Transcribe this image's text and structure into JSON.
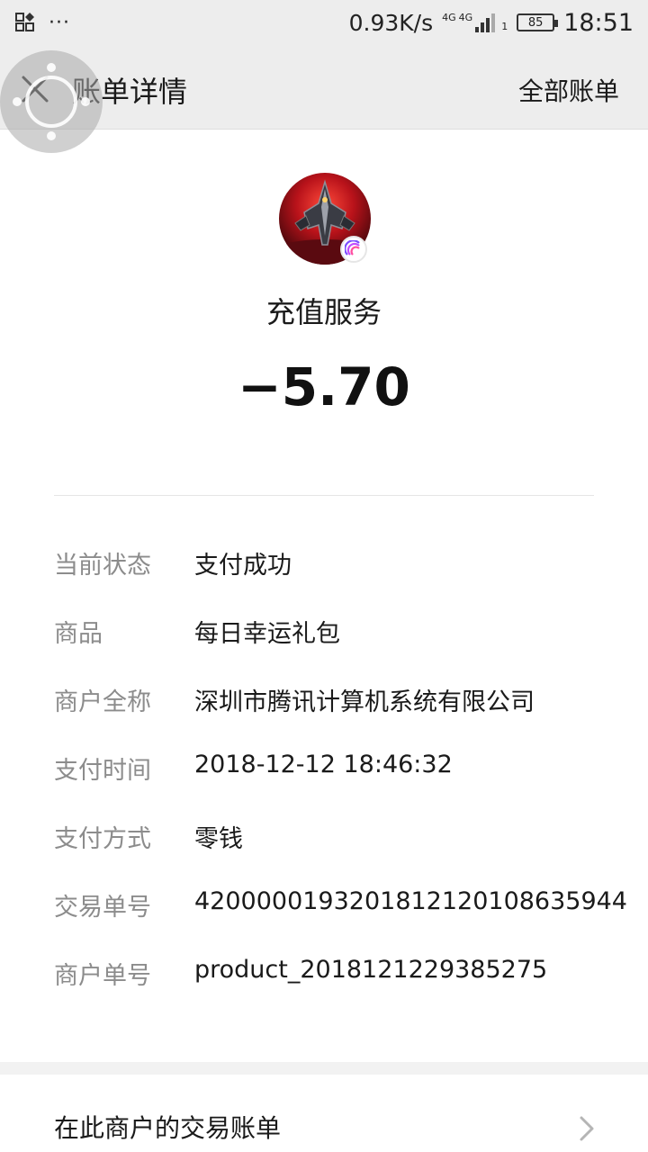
{
  "status_bar": {
    "net_speed": "0.93K/s",
    "signal_1": "4G",
    "signal_2": "4G",
    "sim": "1",
    "battery": "85",
    "time": "18:51"
  },
  "header": {
    "title": "账单详情",
    "all_bills": "全部账单"
  },
  "merchant": {
    "name": "充值服务",
    "amount": "−5.70"
  },
  "details": [
    {
      "label": "当前状态",
      "value": "支付成功"
    },
    {
      "label": "商品",
      "value": "每日幸运礼包"
    },
    {
      "label": "商户全称",
      "value": "深圳市腾讯计算机系统有限公司"
    },
    {
      "label": "支付时间",
      "value": "2018-12-12 18:46:32"
    },
    {
      "label": "支付方式",
      "value": "零钱"
    },
    {
      "label": "交易单号",
      "value": "4200000193201812120108635944"
    },
    {
      "label": "商户单号",
      "value": "product_2018121229385275"
    }
  ],
  "footer_link": {
    "label": "在此商户的交易账单"
  },
  "icons": {
    "close": "close-icon",
    "chevron": "chevron-right-icon",
    "floating": "floating-window-icon"
  },
  "colors": {
    "header_bg": "#ededed",
    "label_gray": "#8c8c8c",
    "text": "#1a1a1a"
  }
}
